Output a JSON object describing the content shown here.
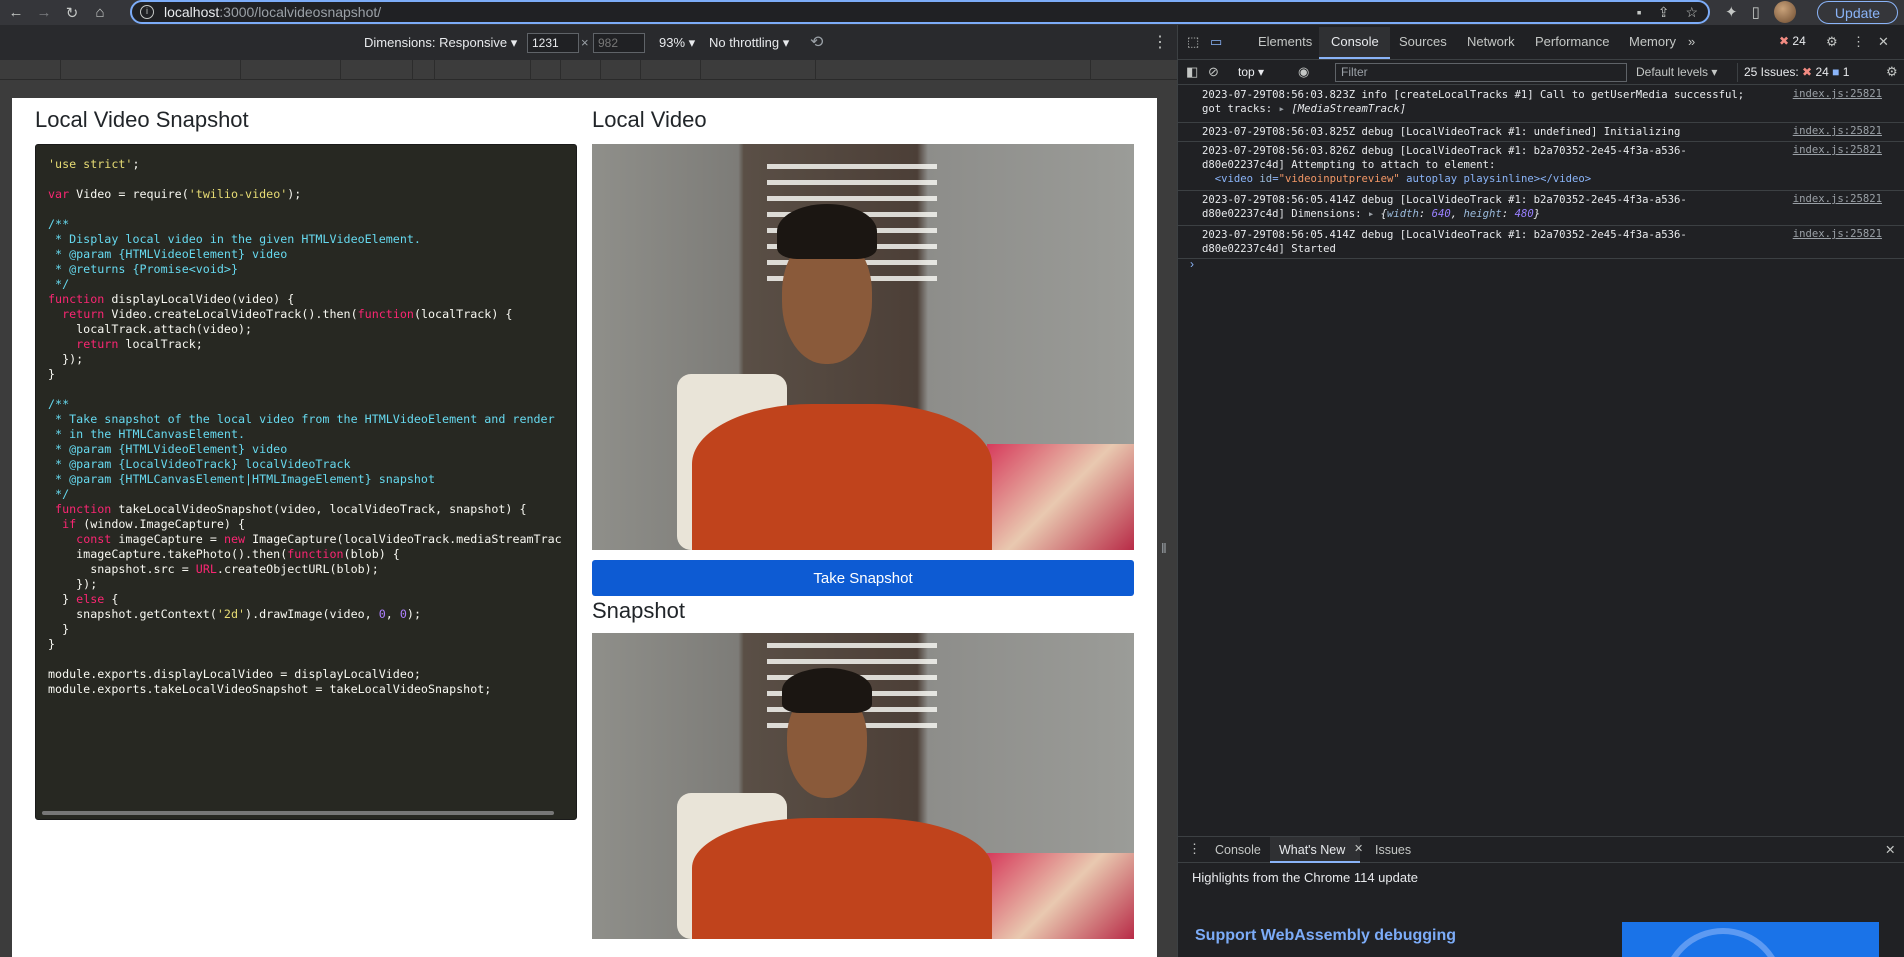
{
  "browser": {
    "url_host": "localhost",
    "url_path": ":3000/localvideosnapshot/",
    "update_label": "Update"
  },
  "device_toolbar": {
    "dimensions_label": "Dimensions: Responsive",
    "width": "1231",
    "height": "982",
    "zoom": "93%",
    "throttling": "No throttling"
  },
  "page": {
    "left_heading": "Local Video Snapshot",
    "local_video_heading": "Local Video",
    "snapshot_heading": "Snapshot",
    "take_snapshot_label": "Take Snapshot",
    "code_lines": [
      "'use strict';",
      "",
      "var Video = require('twilio-video');",
      "",
      "/**",
      " * Display local video in the given HTMLVideoElement.",
      " * @param {HTMLVideoElement} video",
      " * @returns {Promise<void>}",
      " */",
      "function displayLocalVideo(video) {",
      "  return Video.createLocalVideoTrack().then(function(localTrack) {",
      "    localTrack.attach(video);",
      "    return localTrack;",
      "  });",
      "}",
      "",
      "/**",
      " * Take snapshot of the local video from the HTMLVideoElement and render",
      " * in the HTMLCanvasElement.",
      " * @param {HTMLVideoElement} video",
      " * @param {LocalVideoTrack} localVideoTrack",
      " * @param {HTMLCanvasElement|HTMLImageElement} snapshot",
      " */",
      " function takeLocalVideoSnapshot(video, localVideoTrack, snapshot) {",
      "  if (window.ImageCapture) {",
      "    const imageCapture = new ImageCapture(localVideoTrack.mediaStreamTrac",
      "    imageCapture.takePhoto().then(function(blob) {",
      "      snapshot.src = URL.createObjectURL(blob);",
      "    });",
      "  } else {",
      "    snapshot.getContext('2d').drawImage(video, 0, 0);",
      "  }",
      "}",
      "",
      "module.exports.displayLocalVideo = displayLocalVideo;",
      "module.exports.takeLocalVideoSnapshot = takeLocalVideoSnapshot;"
    ]
  },
  "devtools": {
    "tabs": [
      "Elements",
      "Console",
      "Sources",
      "Network",
      "Performance",
      "Memory"
    ],
    "error_count": "24",
    "context": "top",
    "filter_placeholder": "Filter",
    "levels": "Default levels",
    "issues_label": "25 Issues:",
    "issues_errors": "24",
    "issues_info": "1",
    "logs": [
      {
        "src": "index.js:25821"
      },
      {
        "src": "index.js:25821"
      },
      {
        "src": "index.js:25821"
      },
      {
        "src": "index.js:25821"
      },
      {
        "src": "index.js:25821"
      }
    ],
    "log_text": {
      "l1a": "2023-07-29T08:56:03.823Z info [createLocalTracks #1] Call to getUserMedia successful;",
      "l1b": "got tracks: ",
      "l1c": "[MediaStreamTrack]",
      "l2": "2023-07-29T08:56:03.825Z debug [LocalVideoTrack #1: undefined] Initializing",
      "l3a": "2023-07-29T08:56:03.826Z debug [LocalVideoTrack #1: b2a70352-2e45-4f3a-a536-",
      "l3b": "d80e02237c4d] Attempting to attach to element:",
      "l3c_tag_open": "<video ",
      "l3c_attr": "id",
      "l3c_val": "\"videoinputpreview\"",
      "l3c_rest": " autoplay playsinline></video>",
      "l4a": "2023-07-29T08:56:05.414Z debug [LocalVideoTrack #1: b2a70352-2e45-4f3a-a536-",
      "l4b": "d80e02237c4d] Dimensions: ",
      "l4_width_key": "width",
      "l4_width": "640",
      "l4_height_key": "height",
      "l4_height": "480",
      "l5a": "2023-07-29T08:56:05.414Z debug [LocalVideoTrack #1: b2a70352-2e45-4f3a-a536-",
      "l5b": "d80e02237c4d] Started"
    },
    "drawer_tabs": [
      "Console",
      "What's New",
      "Issues"
    ],
    "whats_new_header": "Highlights from the Chrome 114 update",
    "whats_new_title": "Support WebAssembly debugging"
  }
}
